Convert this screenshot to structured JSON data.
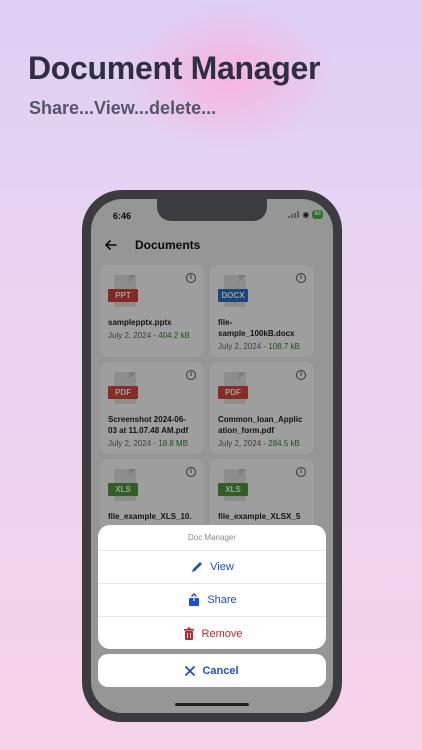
{
  "promo": {
    "title": "Document Manager",
    "subtitle": "Share...View...delete..."
  },
  "status_bar": {
    "time": "6:46",
    "battery": "82"
  },
  "app_bar": {
    "title": "Documents",
    "back_icon": "arrow-left-icon"
  },
  "documents": [
    {
      "type": "PPT",
      "color": "#d0463a",
      "name": "samplepptx.pptx",
      "date": "July 2, 2024",
      "size": "404.2 kB"
    },
    {
      "type": "DOCX",
      "color": "#2b73c4",
      "name": "file-\nsample_100kB.docx",
      "date": "July 2, 2024",
      "size": "108.7 kB"
    },
    {
      "type": "PDF",
      "color": "#d84a3e",
      "name": "Screenshot 2024-06-\n03 at 11.07.48 AM.pdf",
      "date": "July 2, 2024",
      "size": "18.8 MB"
    },
    {
      "type": "PDF",
      "color": "#d84a3e",
      "name": "Common_loan_Applic\nation_form.pdf",
      "date": "July 2, 2024",
      "size": "284.5 kB"
    },
    {
      "type": "XLS",
      "color": "#4f9a3a",
      "name": "file_example_XLS_10.",
      "date": "",
      "size": ""
    },
    {
      "type": "XLS",
      "color": "#4f9a3a",
      "name": "file_example_XLSX_5",
      "date": "",
      "size": ""
    }
  ],
  "action_sheet": {
    "title": "Doc Manager",
    "view_label": "View",
    "share_label": "Share",
    "remove_label": "Remove",
    "cancel_label": "Cancel",
    "accent_color": "#1a50c8",
    "danger_color": "#c0262d"
  }
}
